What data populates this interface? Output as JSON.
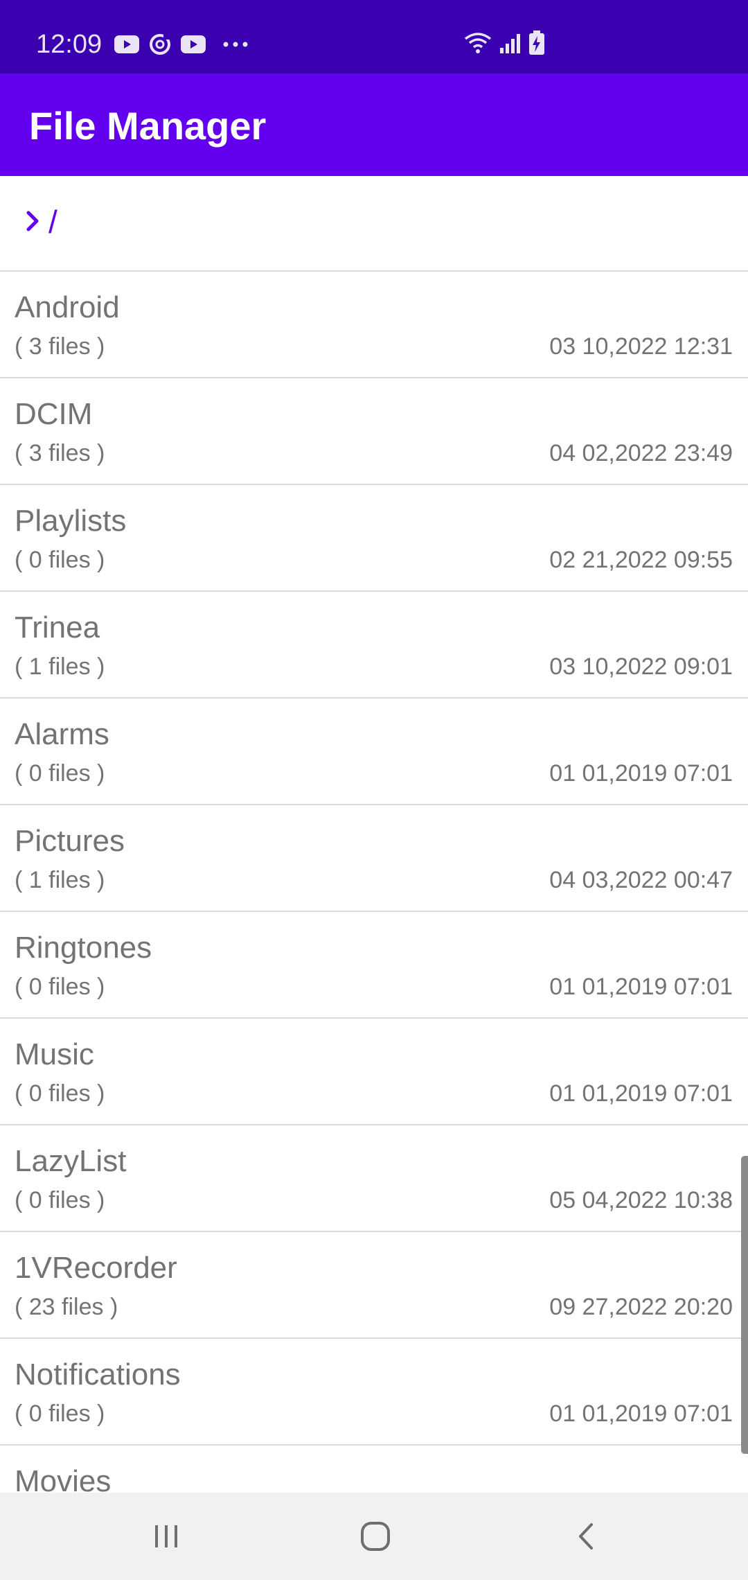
{
  "status_bar": {
    "time": "12:09",
    "left_icons": [
      "youtube-icon",
      "sync-icon",
      "youtube-icon",
      "more-icon"
    ],
    "right_icons": [
      "wifi-icon",
      "signal-icon",
      "battery-charging-icon"
    ],
    "background_color": "#3b00b0"
  },
  "app_bar": {
    "title": "File Manager",
    "background_color": "#6200ee"
  },
  "breadcrumb": {
    "icon": "chevron-right-icon",
    "path": "/"
  },
  "files": [
    {
      "name": "Android",
      "count": "( 3 files )",
      "date": "03 10,2022 12:31"
    },
    {
      "name": "DCIM",
      "count": "( 3 files )",
      "date": "04 02,2022 23:49"
    },
    {
      "name": "Playlists",
      "count": "( 0 files )",
      "date": "02 21,2022 09:55"
    },
    {
      "name": "Trinea",
      "count": "( 1 files )",
      "date": "03 10,2022 09:01"
    },
    {
      "name": "Alarms",
      "count": "( 0 files )",
      "date": "01 01,2019 07:01"
    },
    {
      "name": "Pictures",
      "count": "( 1 files )",
      "date": "04 03,2022 00:47"
    },
    {
      "name": "Ringtones",
      "count": "( 0 files )",
      "date": "01 01,2019 07:01"
    },
    {
      "name": "Music",
      "count": "( 0 files )",
      "date": "01 01,2019 07:01"
    },
    {
      "name": "LazyList",
      "count": "( 0 files )",
      "date": "05 04,2022 10:38"
    },
    {
      "name": "1VRecorder",
      "count": "( 23 files )",
      "date": "09 27,2022 20:20"
    },
    {
      "name": "Notifications",
      "count": "( 0 files )",
      "date": "01 01,2019 07:01"
    },
    {
      "name": "Movies",
      "count": "",
      "date": ""
    }
  ],
  "nav_bar": {
    "buttons": [
      "recents-icon",
      "home-icon",
      "back-icon"
    ]
  }
}
